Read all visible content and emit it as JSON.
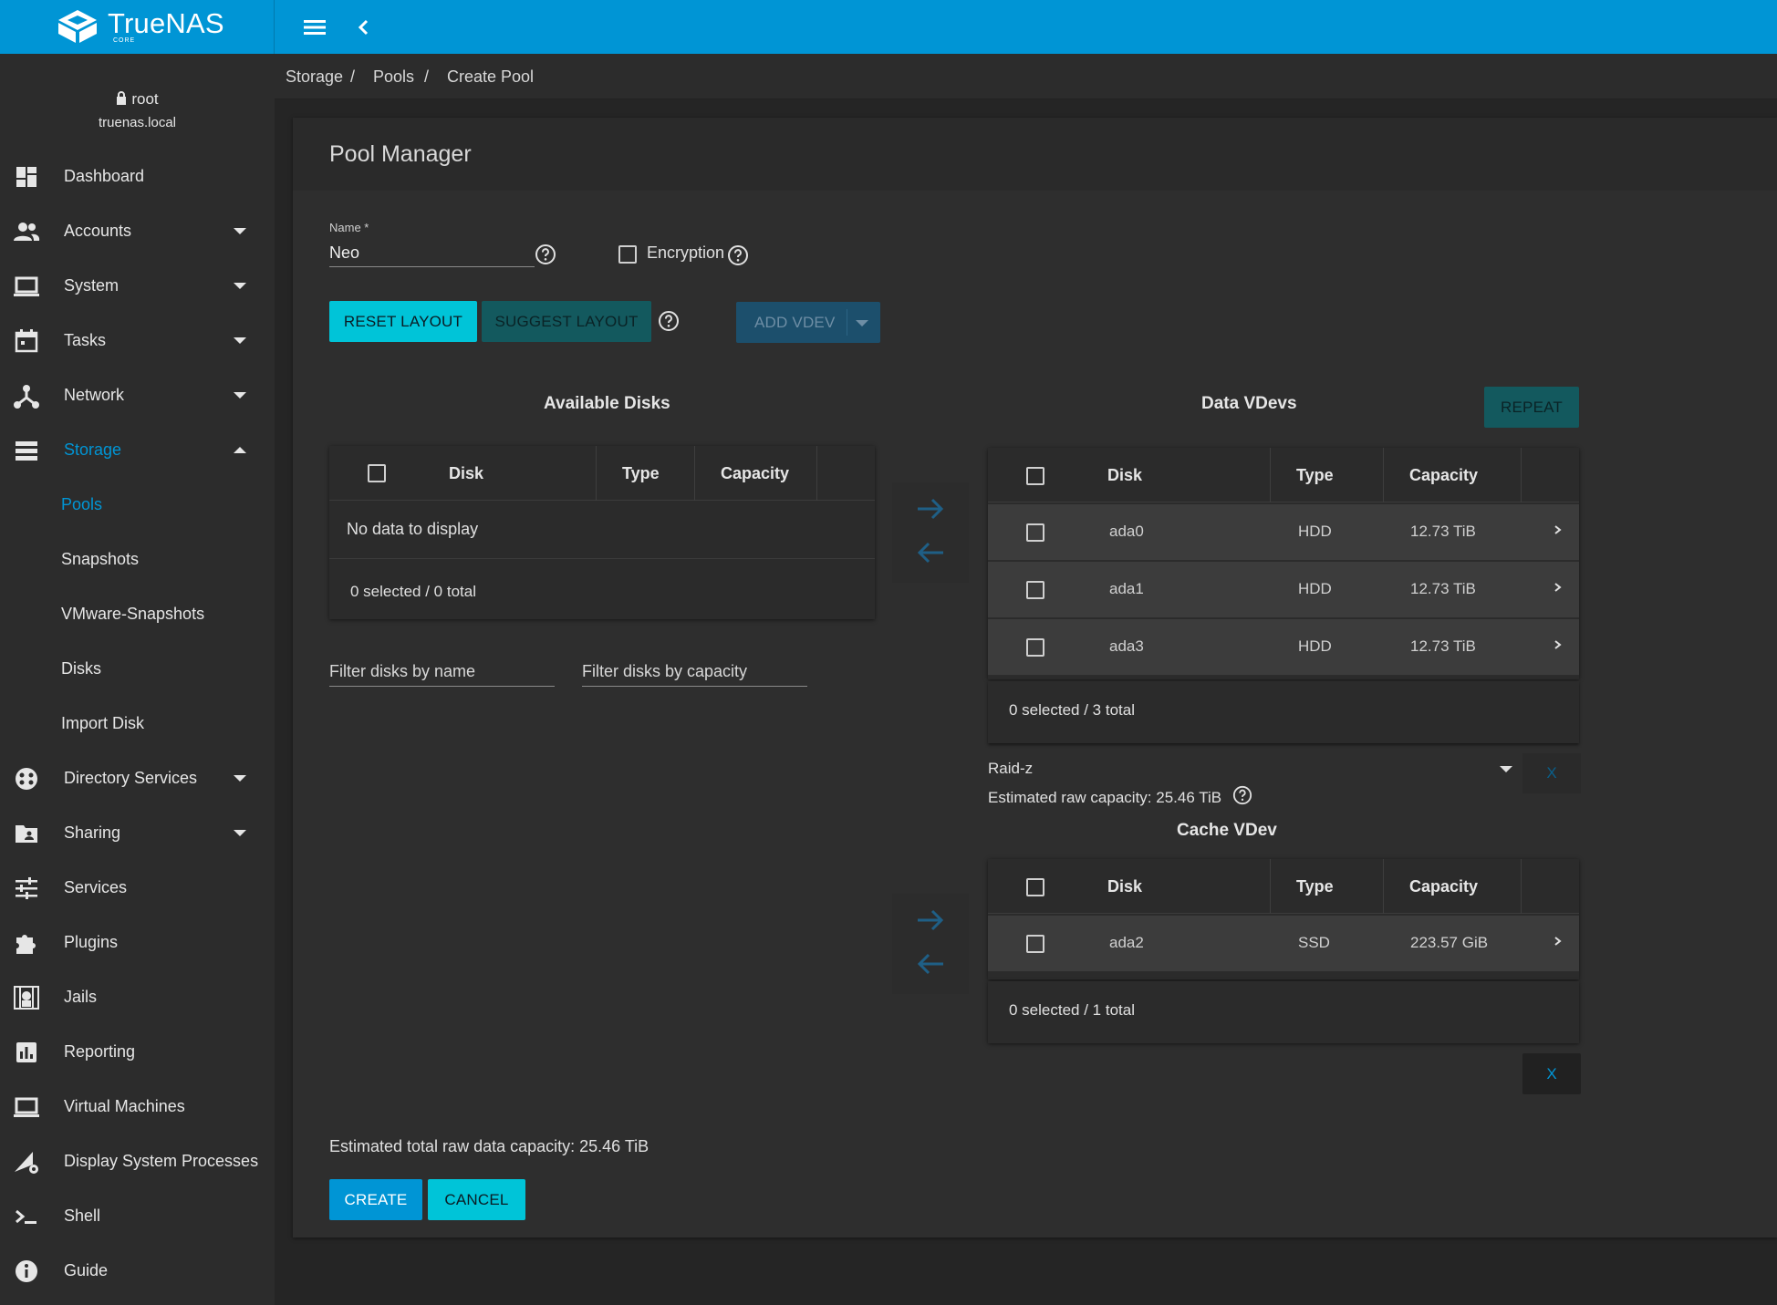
{
  "app": {
    "logo_text": "TrueNAS",
    "logo_sub": "CORE"
  },
  "user": {
    "name": "root",
    "host": "truenas.local"
  },
  "nav": {
    "dashboard": "Dashboard",
    "accounts": "Accounts",
    "system": "System",
    "tasks": "Tasks",
    "network": "Network",
    "storage": "Storage",
    "storage_sub": {
      "pools": "Pools",
      "snapshots": "Snapshots",
      "vmware": "VMware-Snapshots",
      "disks": "Disks",
      "import": "Import Disk"
    },
    "directory": "Directory Services",
    "sharing": "Sharing",
    "services": "Services",
    "plugins": "Plugins",
    "jails": "Jails",
    "reporting": "Reporting",
    "vms": "Virtual Machines",
    "processes": "Display System Processes",
    "shell": "Shell",
    "guide": "Guide"
  },
  "breadcrumb": {
    "c1": "Storage",
    "c2": "Pools",
    "c3": "Create Pool",
    "sep": "/"
  },
  "page": {
    "title": "Pool Manager",
    "name_label": "Name *",
    "name_value": "Neo",
    "encryption_label": "Encryption",
    "reset_layout": "RESET LAYOUT",
    "suggest_layout": "SUGGEST LAYOUT",
    "add_vdev": "ADD VDEV",
    "repeat": "REPEAT",
    "create": "CREATE",
    "cancel": "CANCEL",
    "x_label": "X",
    "est_total": "Estimated total raw data capacity: 25.46 TiB"
  },
  "available": {
    "title": "Available Disks",
    "columns": {
      "disk": "Disk",
      "type": "Type",
      "capacity": "Capacity"
    },
    "empty": "No data to display",
    "footer": "0 selected / 0 total",
    "filter_name": "Filter disks by name",
    "filter_capacity": "Filter disks by capacity"
  },
  "data_vdevs": {
    "title": "Data VDevs",
    "columns": {
      "disk": "Disk",
      "type": "Type",
      "capacity": "Capacity"
    },
    "rows": [
      {
        "disk": "ada0",
        "type": "HDD",
        "capacity": "12.73 TiB"
      },
      {
        "disk": "ada1",
        "type": "HDD",
        "capacity": "12.73 TiB"
      },
      {
        "disk": "ada3",
        "type": "HDD",
        "capacity": "12.73 TiB"
      }
    ],
    "footer": "0 selected / 3 total",
    "layout": "Raid-z",
    "est_raw": "Estimated raw capacity: 25.46 TiB"
  },
  "cache_vdev": {
    "title": "Cache VDev",
    "columns": {
      "disk": "Disk",
      "type": "Type",
      "capacity": "Capacity"
    },
    "rows": [
      {
        "disk": "ada2",
        "type": "SSD",
        "capacity": "223.57 GiB"
      }
    ],
    "footer": "0 selected / 1 total"
  },
  "colors": {
    "accent": "#0095d5",
    "teal": "#00c4d8",
    "dark_teal": "#13595e"
  }
}
